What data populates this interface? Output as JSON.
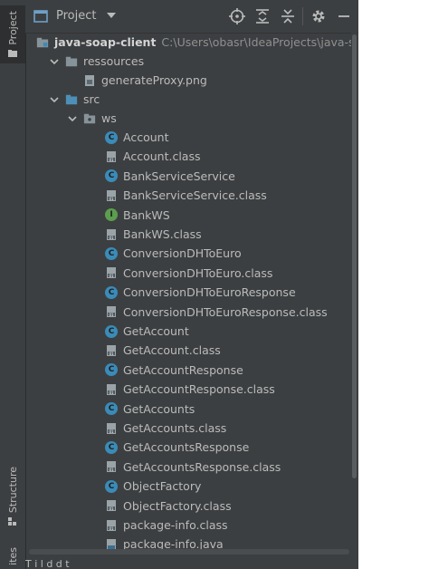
{
  "sidebar": {
    "tabs": [
      {
        "label": "Project",
        "active": true
      },
      {
        "label": "Structure",
        "active": false
      },
      {
        "label": "ites",
        "active": false
      }
    ]
  },
  "header": {
    "title": "Project",
    "icons": [
      "project-view-icon",
      "dropdown-caret-icon",
      "locate-icon",
      "expand-all-icon",
      "collapse-all-icon",
      "gear-icon",
      "minimize-icon"
    ]
  },
  "tree": {
    "root": {
      "label": "java-soap-client",
      "path": "C:\\Users\\obasr\\IdeaProjects\\java-soap"
    },
    "folders": {
      "ressources": "ressources",
      "src": "src",
      "ws": "ws"
    },
    "resource_file": "generateProxy.png",
    "ws_items": [
      {
        "label": "Account",
        "kind": "class"
      },
      {
        "label": "Account.class",
        "kind": "classfile"
      },
      {
        "label": "BankServiceService",
        "kind": "class"
      },
      {
        "label": "BankServiceService.class",
        "kind": "classfile"
      },
      {
        "label": "BankWS",
        "kind": "interface"
      },
      {
        "label": "BankWS.class",
        "kind": "classfile"
      },
      {
        "label": "ConversionDHToEuro",
        "kind": "class"
      },
      {
        "label": "ConversionDHToEuro.class",
        "kind": "classfile"
      },
      {
        "label": "ConversionDHToEuroResponse",
        "kind": "class"
      },
      {
        "label": "ConversionDHToEuroResponse.class",
        "kind": "classfile"
      },
      {
        "label": "GetAccount",
        "kind": "class"
      },
      {
        "label": "GetAccount.class",
        "kind": "classfile"
      },
      {
        "label": "GetAccountResponse",
        "kind": "class"
      },
      {
        "label": "GetAccountResponse.class",
        "kind": "classfile"
      },
      {
        "label": "GetAccounts",
        "kind": "class"
      },
      {
        "label": "GetAccounts.class",
        "kind": "classfile"
      },
      {
        "label": "GetAccountsResponse",
        "kind": "class"
      },
      {
        "label": "GetAccountsResponse.class",
        "kind": "classfile"
      },
      {
        "label": "ObjectFactory",
        "kind": "class"
      },
      {
        "label": "ObjectFactory.class",
        "kind": "classfile"
      },
      {
        "label": "package-info.class",
        "kind": "classfile"
      },
      {
        "label": "package-info.java",
        "kind": "javafile"
      }
    ]
  },
  "bottom_bar": {
    "text": "T    i   l   d   d   t"
  },
  "colors": {
    "panel_bg": "#3c3f41",
    "text": "#bbbbbb",
    "class_icon": "#3b8bb8",
    "interface_icon": "#5c9e4f",
    "folder": "#87939a"
  }
}
